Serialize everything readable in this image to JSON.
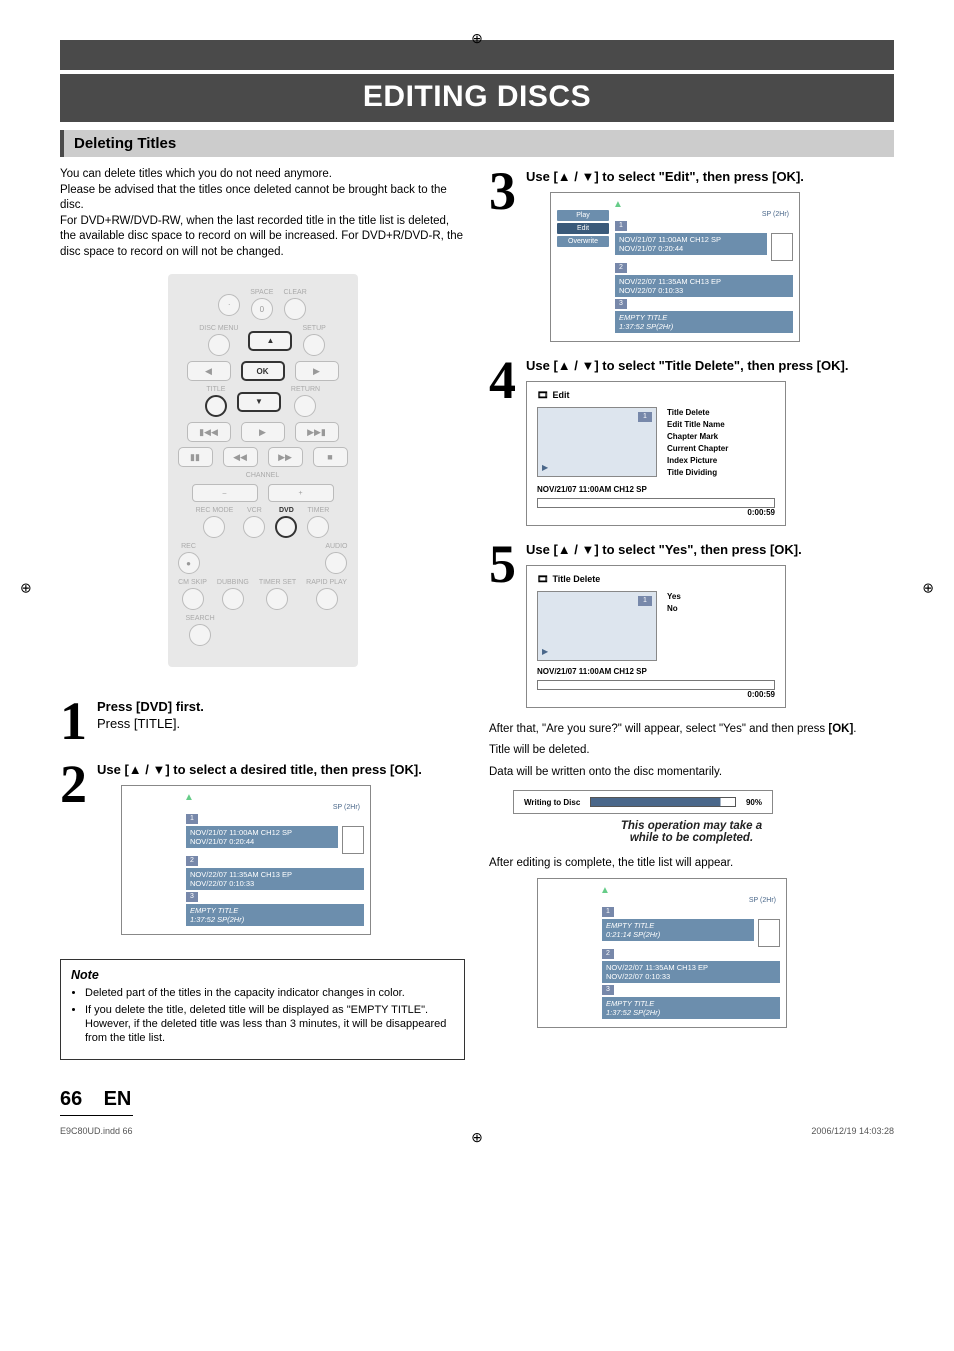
{
  "registration_mark": "⊕",
  "header": {
    "title": "EDITING DISCS"
  },
  "section": {
    "title": "Deleting Titles"
  },
  "intro": {
    "p1": "You can delete titles which you do not need anymore.",
    "p2": "Please be advised that the titles once deleted cannot be brought back to the disc.",
    "p3": "For DVD+RW/DVD-RW, when the last recorded title in the title list is deleted, the available disc space to record on will be increased. For DVD+R/DVD-R, the disc space to record on will not be changed."
  },
  "remote": {
    "labels": {
      "space": "SPACE",
      "clear": "CLEAR",
      "disc_menu": "DISC MENU",
      "setup": "SETUP",
      "ok": "OK",
      "title": "TITLE",
      "return": "RETURN",
      "channel": "CHANNEL",
      "rec_mode": "REC MODE",
      "vcr": "VCR",
      "dvd": "DVD",
      "timer": "TIMER",
      "rec": "REC",
      "audio": "AUDIO",
      "cm_skip": "CM SKIP",
      "dubbing": "DUBBING",
      "timer_set": "TIMER SET",
      "rapid_play": "RAPID PLAY",
      "search": "SEARCH",
      "zero": "0",
      "minus": "–",
      "plus": "+"
    }
  },
  "steps": {
    "s1": {
      "num": "1",
      "line1": "Press [DVD] first.",
      "line2": "Press [TITLE]."
    },
    "s2": {
      "num": "2",
      "head": "Use [▲ / ▼] to select a desired title, then press [OK]."
    },
    "s3": {
      "num": "3",
      "head": "Use [▲ / ▼] to select \"Edit\", then press [OK]."
    },
    "s4": {
      "num": "4",
      "head": "Use [▲ / ▼] to select \"Title Delete\", then press [OK]."
    },
    "s5": {
      "num": "5",
      "head": "Use [▲ / ▼] to select \"Yes\", then press [OK]."
    }
  },
  "titlelist_common": {
    "sp_label": "SP (2Hr)",
    "item1_num": "1",
    "item1_line1": "NOV/21/07  11:00AM CH12  SP",
    "item1_line2": "NOV/21/07    0:20:44",
    "item2_num": "2",
    "item2_line1": "NOV/22/07  11:35AM CH13  EP",
    "item2_line2": "NOV/22/07    0:10:33",
    "item3_num": "3",
    "item3_line1": "EMPTY TITLE",
    "item3_line2": "1:37:52   SP(2Hr)"
  },
  "titlelist_step3_menu": {
    "play": "Play",
    "edit": "Edit",
    "overwrite": "Overwrite"
  },
  "titlelist_after": {
    "item1_line1": "EMPTY TITLE",
    "item1_line2": "0:21:14   SP(2Hr)"
  },
  "edit_screen": {
    "title": "Edit",
    "menu": {
      "title_delete": "Title Delete",
      "edit_title_name": "Edit Title Name",
      "chapter_mark": "Chapter Mark",
      "current_chapter": "Current Chapter",
      "index_picture": "Index Picture",
      "title_dividing": "Title Dividing"
    },
    "footer": "NOV/21/07 11:00AM CH12 SP",
    "time": "0:00:59",
    "one": "1"
  },
  "delete_screen": {
    "title": "Title Delete",
    "yes": "Yes",
    "no": "No",
    "footer": "NOV/21/07 11:00AM CH12 SP",
    "time": "0:00:59",
    "one": "1"
  },
  "after_text": {
    "line1a": "After that, \"Are you sure?\" will appear, select \"Yes\" and then press ",
    "line1b": "[OK]",
    "line1c": ".",
    "line2": "Title will be deleted.",
    "line3": "Data will be written onto the disc momentarily."
  },
  "writing": {
    "label": "Writing to Disc",
    "percent": "90%"
  },
  "op_note": {
    "line1": "This operation may take a",
    "line2": "while to be completed."
  },
  "closing": "After editing is complete, the title list will appear.",
  "note": {
    "title": "Note",
    "b1": "Deleted part of the titles in the capacity indicator changes in color.",
    "b2": "If you delete the title, deleted title will be displayed as \"EMPTY TITLE\". However, if the deleted title was less than 3 minutes, it will be disappeared from the title list."
  },
  "footer": {
    "page": "66",
    "lang": "EN",
    "left_small": "E9C80UD.indd   66",
    "right_small": "2006/12/19   14:03:28"
  }
}
